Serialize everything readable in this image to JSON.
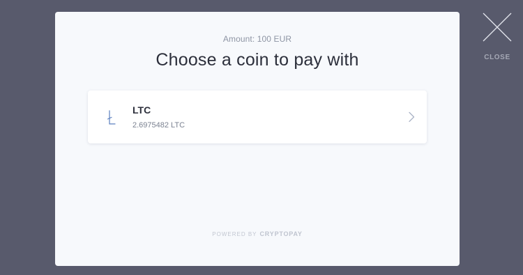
{
  "modal": {
    "amount_text": "Amount: 100 EUR",
    "title": "Choose a coin to pay with"
  },
  "coins": [
    {
      "symbol": "LTC",
      "amount": "2.6975482 LTC",
      "icon": "litecoin-icon"
    }
  ],
  "footer": {
    "powered_by": "POWERED BY",
    "brand": "CRYPTOPAY"
  },
  "close": {
    "label": "CLOSE",
    "icon": "close-icon"
  },
  "colors": {
    "overlay": "#585a6c",
    "modal_bg": "#f7f9fc",
    "card_bg": "#ffffff",
    "title_text": "#2c2f3b",
    "accent_icon": "#5b7fbf"
  }
}
